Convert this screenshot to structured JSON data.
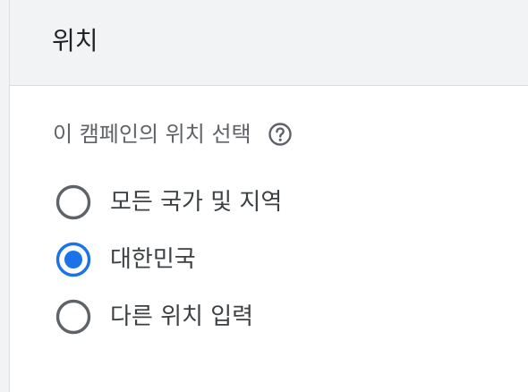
{
  "header": {
    "title": "위치"
  },
  "location": {
    "question": "이 캠페인의 위치 선택",
    "help_icon": "help-circle-icon",
    "options": [
      {
        "label": "모든 국가 및 지역",
        "selected": false
      },
      {
        "label": "대한민국",
        "selected": true
      },
      {
        "label": "다른 위치 입력",
        "selected": false
      }
    ]
  },
  "colors": {
    "header_bg": "#f1f3f4",
    "accent": "#1a73e8",
    "radio_unselected": "#5f6368",
    "text_primary": "#202124",
    "text_secondary": "#5f6368"
  }
}
